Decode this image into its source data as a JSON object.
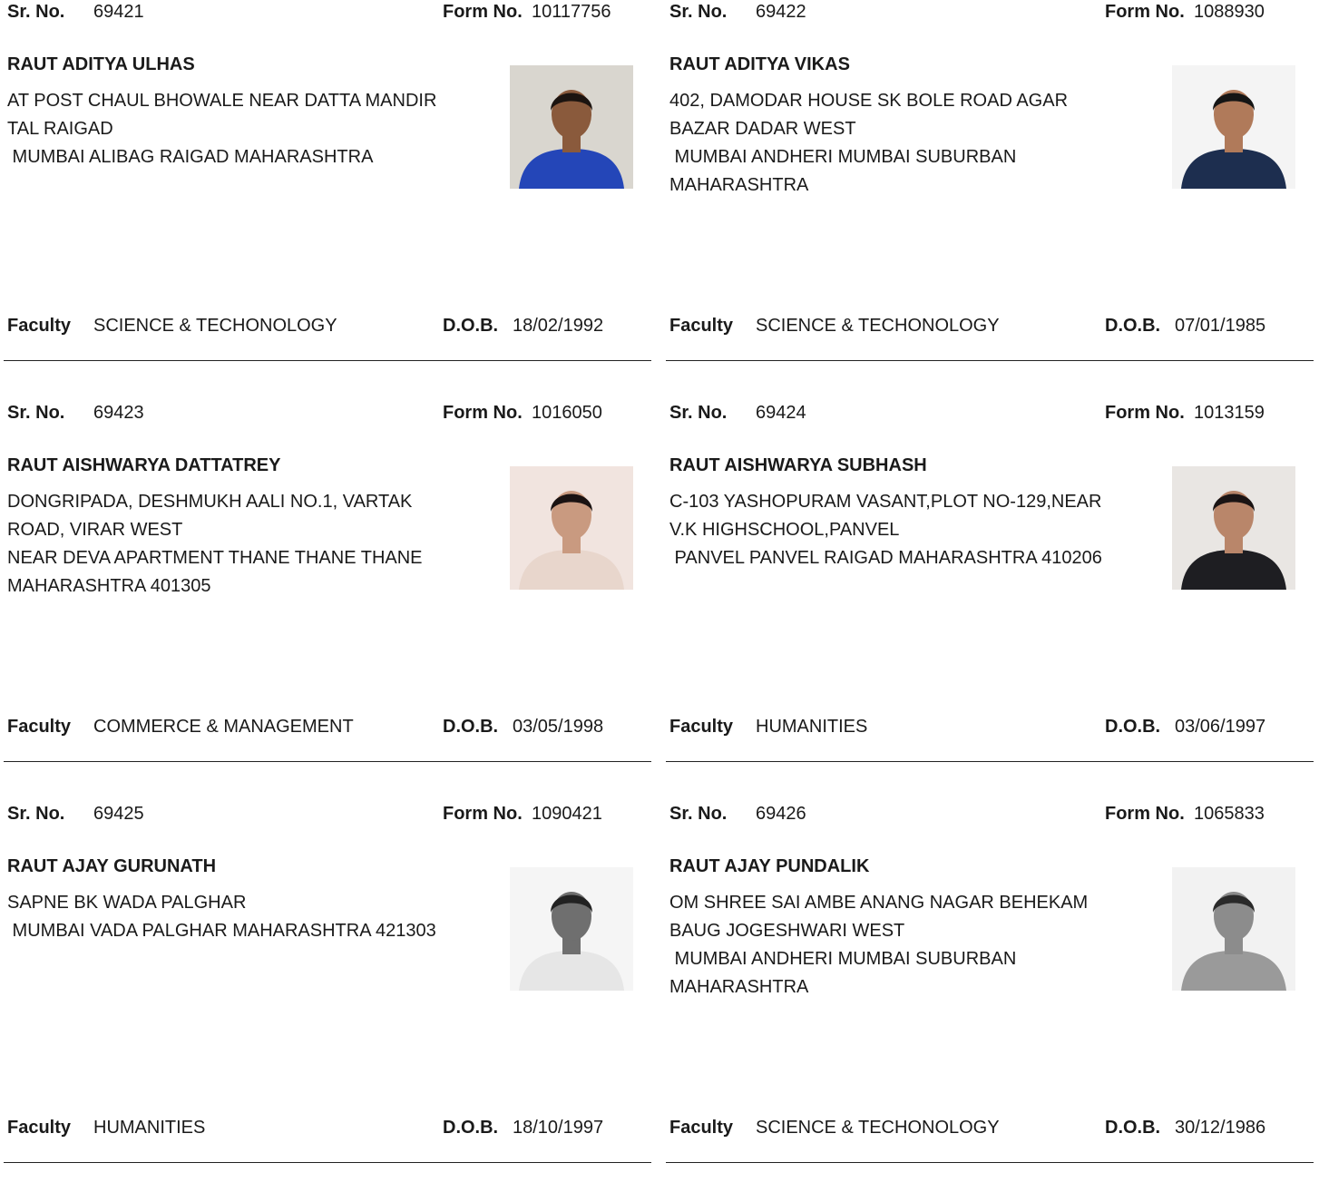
{
  "labels": {
    "sr": "Sr. No.",
    "form": "Form No.",
    "faculty": "Faculty",
    "dob": "D.O.B."
  },
  "records": [
    {
      "sr_no": "69421",
      "form_no": "10117756",
      "name": "RAUT ADITYA ULHAS",
      "address_lines": [
        "AT POST CHAUL BHOWALE NEAR DATTA MANDIR",
        "TAL RAIGAD",
        " MUMBAI ALIBAG RAIGAD MAHARASHTRA"
      ],
      "faculty": "SCIENCE & TECHONOLOGY",
      "dob": "18/02/1992",
      "photo": {
        "bg": "#d9d6cf",
        "shirt": "#2446b8",
        "skin": "#8a5a3c",
        "hair": "#1c1410"
      }
    },
    {
      "sr_no": "69422",
      "form_no": "1088930",
      "name": "RAUT ADITYA VIKAS",
      "address_lines": [
        "402, DAMODAR HOUSE SK BOLE ROAD AGAR",
        "BAZAR DADAR WEST",
        " MUMBAI ANDHERI MUMBAI SUBURBAN",
        "MAHARASHTRA"
      ],
      "faculty": "SCIENCE & TECHONOLOGY",
      "dob": "07/01/1985",
      "photo": {
        "bg": "#f4f4f4",
        "shirt": "#1d2e4f",
        "skin": "#b07a5a",
        "hair": "#151515"
      }
    },
    {
      "sr_no": "69423",
      "form_no": "1016050",
      "name": "RAUT AISHWARYA DATTATREY",
      "address_lines": [
        "DONGRIPADA, DESHMUKH AALI NO.1, VARTAK",
        "ROAD, VIRAR WEST",
        "NEAR DEVA APARTMENT THANE THANE THANE",
        "MAHARASHTRA 401305"
      ],
      "faculty": "COMMERCE & MANAGEMENT",
      "dob": "03/05/1998",
      "photo": {
        "bg": "#f1e4df",
        "shirt": "#e8d6cc",
        "skin": "#c99a80",
        "hair": "#1a1212"
      }
    },
    {
      "sr_no": "69424",
      "form_no": "1013159",
      "name": "RAUT AISHWARYA SUBHASH",
      "address_lines": [
        "C-103 YASHOPURAM VASANT,PLOT NO-129,NEAR",
        "V.K HIGHSCHOOL,PANVEL",
        " PANVEL PANVEL RAIGAD MAHARASHTRA 410206"
      ],
      "faculty": "HUMANITIES",
      "dob": "03/06/1997",
      "photo": {
        "bg": "#e9e6e3",
        "shirt": "#1e1e22",
        "skin": "#b9866a",
        "hair": "#1a1414"
      }
    },
    {
      "sr_no": "69425",
      "form_no": "1090421",
      "name": "RAUT AJAY GURUNATH",
      "address_lines": [
        "SAPNE BK WADA PALGHAR",
        " MUMBAI VADA PALGHAR MAHARASHTRA 421303"
      ],
      "faculty": "HUMANITIES",
      "dob": "18/10/1997",
      "photo": {
        "bg": "#f5f5f5",
        "shirt": "#e6e6e6",
        "skin": "#6f6f6f",
        "hair": "#222222"
      }
    },
    {
      "sr_no": "69426",
      "form_no": "1065833",
      "name": "RAUT AJAY PUNDALIK",
      "address_lines": [
        "OM SHREE SAI AMBE ANANG NAGAR BEHEKAM",
        "BAUG JOGESHWARI WEST",
        " MUMBAI ANDHERI MUMBAI SUBURBAN",
        "MAHARASHTRA"
      ],
      "faculty": "SCIENCE & TECHONOLOGY",
      "dob": "30/12/1986",
      "photo": {
        "bg": "#f2f2f2",
        "shirt": "#9a9a9a",
        "skin": "#8c8c8c",
        "hair": "#2a2a2a"
      }
    }
  ]
}
